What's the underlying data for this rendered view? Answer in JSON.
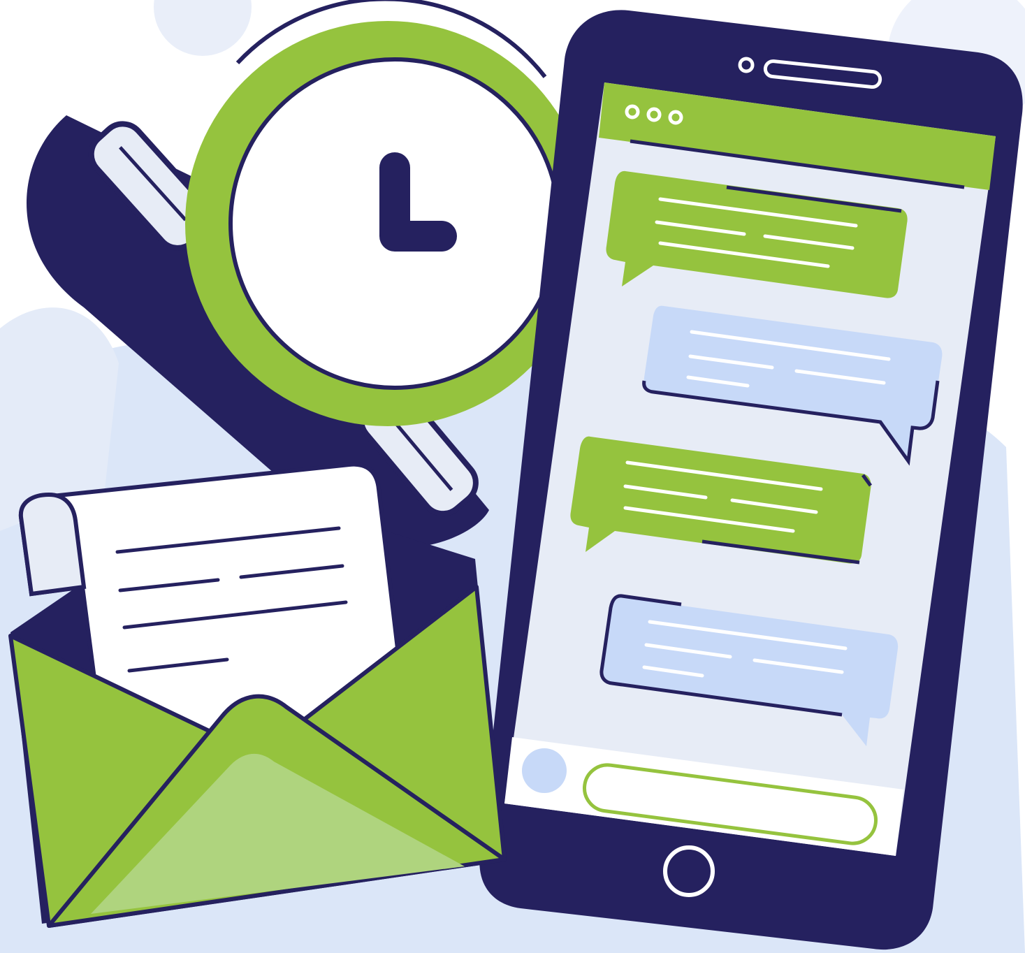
{
  "palette": {
    "navy": "#25215f",
    "green": "#95c33e",
    "light_green": "#afd47e",
    "pale_blue": "#e7ecf6",
    "bubble_blue": "#c7d9f8",
    "background_blob": "#dbe6f8",
    "white": "#ffffff"
  },
  "phone": {
    "header_dots": [
      "dot",
      "dot",
      "dot"
    ],
    "message_bubbles": [
      {
        "side": "incoming",
        "color": "green"
      },
      {
        "side": "outgoing",
        "color": "blue"
      },
      {
        "side": "incoming",
        "color": "green"
      },
      {
        "side": "outgoing",
        "color": "blue"
      }
    ],
    "composer": {
      "avatar": "avatar-circle",
      "input": "message-input"
    }
  },
  "icons": [
    "smartphone-icon",
    "chat-bubble-icon",
    "clock-icon",
    "telephone-handset-icon",
    "envelope-icon",
    "letter-icon"
  ]
}
